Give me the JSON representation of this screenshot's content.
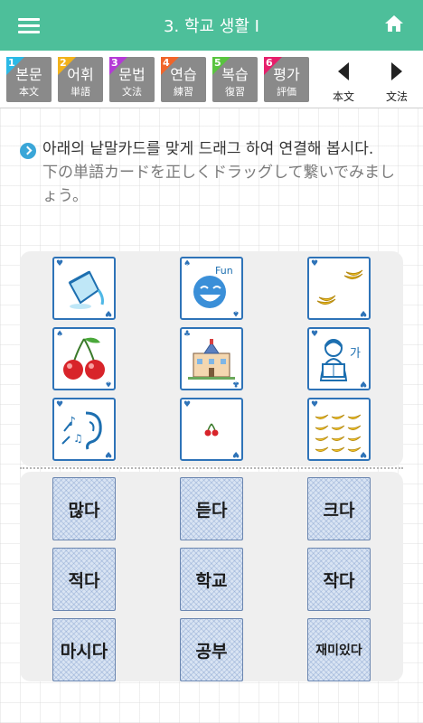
{
  "header": {
    "title": "3. 학교 생활 I",
    "menu_icon": "hamburger-menu-icon",
    "home_icon": "home-icon",
    "bg_color": "#4dbf9a"
  },
  "tabs": [
    {
      "num": "1",
      "kr": "본문",
      "ja": "本文",
      "color": "#2bb9e6"
    },
    {
      "num": "2",
      "kr": "어휘",
      "ja": "単語",
      "color": "#f2b21b"
    },
    {
      "num": "3",
      "kr": "문법",
      "ja": "文法",
      "color": "#b43ad6"
    },
    {
      "num": "4",
      "kr": "연습",
      "ja": "練習",
      "color": "#f0652a"
    },
    {
      "num": "5",
      "kr": "복습",
      "ja": "復習",
      "color": "#59c43f"
    },
    {
      "num": "6",
      "kr": "평가",
      "ja": "評価",
      "color": "#e61f6b"
    }
  ],
  "nav": {
    "prev_label": "本文",
    "next_label": "文法"
  },
  "instruction": {
    "kr": "아래의 낱말카드를 맞게 드래그 하여 연결해 봅시다.",
    "ja": "下の単語カードを正しくドラッグして繋いでみましょう。"
  },
  "picture_cards": [
    {
      "icon": "pouring-cup-icon"
    },
    {
      "icon": "laughing-face-icon",
      "caption": "Fun"
    },
    {
      "icon": "few-bananas-icon"
    },
    {
      "icon": "big-cherries-icon"
    },
    {
      "icon": "school-building-icon"
    },
    {
      "icon": "student-reading-icon",
      "caption": "가"
    },
    {
      "icon": "ear-listening-icon"
    },
    {
      "icon": "small-cherry-icon"
    },
    {
      "icon": "many-bananas-icon"
    }
  ],
  "word_cards": [
    "많다",
    "듣다",
    "크다",
    "적다",
    "학교",
    "작다",
    "마시다",
    "공부",
    "재미있다"
  ]
}
